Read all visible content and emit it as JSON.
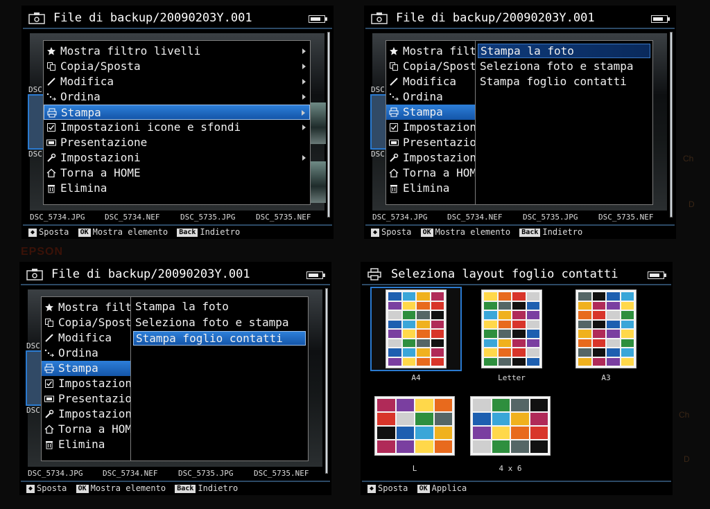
{
  "background": {
    "brand": "EPSON",
    "frag_ch": "Ch",
    "frag_d": "D"
  },
  "colors": {
    "accent": "#1f6fc8",
    "highlight": "#0e3a7a",
    "border": "#7d7d7d",
    "text": "#f0f0f0"
  },
  "screens": [
    {
      "title": "File di backup/20090203Y.001",
      "sidelabels": [
        "DSC",
        "DSC"
      ],
      "files": [
        "DSC_5734.JPG",
        "DSC_5734.NEF",
        "DSC_5735.JPG",
        "DSC_5735.NEF"
      ],
      "footer": {
        "k1": "◆",
        "l1": "Sposta",
        "k2": "OK",
        "l2": "Mostra elemento",
        "k3": "Back",
        "l3": "Indietro"
      },
      "menu": [
        {
          "label": "Mostra filtro livelli",
          "icon": "star-icon"
        },
        {
          "label": "Copia/Sposta",
          "icon": "copy-icon"
        },
        {
          "label": "Modifica",
          "icon": "pencil-icon"
        },
        {
          "label": "Ordina",
          "icon": "sort-icon"
        },
        {
          "label": "Stampa",
          "icon": "printer-icon"
        },
        {
          "label": "Impostazioni icone e sfondi",
          "icon": "checkbox-icon"
        },
        {
          "label": "Presentazione",
          "icon": "slideshow-icon"
        },
        {
          "label": "Impostazioni",
          "icon": "wrench-icon"
        },
        {
          "label": "Torna a HOME",
          "icon": "home-icon"
        },
        {
          "label": "Elimina",
          "icon": "trash-icon"
        }
      ]
    },
    {
      "title": "File di backup/20090203Y.001",
      "sidelabels": [
        "DSC",
        "DSC"
      ],
      "files": [
        "DSC_5734.JPG",
        "DSC_5734.NEF",
        "DSC_5735.JPG",
        "DSC_5735.NEF"
      ],
      "footer": {
        "k1": "◆",
        "l1": "Sposta",
        "k2": "OK",
        "l2": "Mostra elemento",
        "k3": "Back",
        "l3": "Indietro"
      },
      "menu": [
        "Mostra filtro",
        "Copia/Sposta",
        "Modifica",
        "Ordina",
        "Stampa",
        "Impostazioni",
        "Presentazione",
        "Impostazioni",
        "Torna a HOME",
        "Elimina"
      ],
      "submenu": [
        "Stampa la foto",
        "Seleziona foto e stampa",
        "Stampa foglio contatti"
      ]
    },
    {
      "title": "File di backup/20090203Y.001",
      "sidelabels": [
        "DSC",
        "DSC"
      ],
      "files": [
        "DSC_5734.JPG",
        "DSC_5734.NEF",
        "DSC_5735.JPG",
        "DSC_5735.NEF"
      ],
      "footer": {
        "k1": "◆",
        "l1": "Sposta",
        "k2": "OK",
        "l2": "Mostra elemento",
        "k3": "Back",
        "l3": "Indietro"
      },
      "menu": [
        "Mostra filtro",
        "Copia/Sposta",
        "Modifica",
        "Ordina",
        "Stampa",
        "Impostazioni",
        "Presentazione",
        "Impostazioni",
        "Torna a HOME",
        "Elimina"
      ],
      "submenu": [
        "Stampa la foto",
        "Seleziona foto e stampa",
        "Stampa foglio contatti"
      ]
    },
    {
      "title": "Seleziona layout foglio contatti",
      "layouts": [
        "A4",
        "Letter",
        "A3",
        "L",
        "4 x 6"
      ],
      "footer": {
        "k1": "◆",
        "l1": "Sposta",
        "k2": "OK",
        "l2": "Applica"
      }
    }
  ]
}
